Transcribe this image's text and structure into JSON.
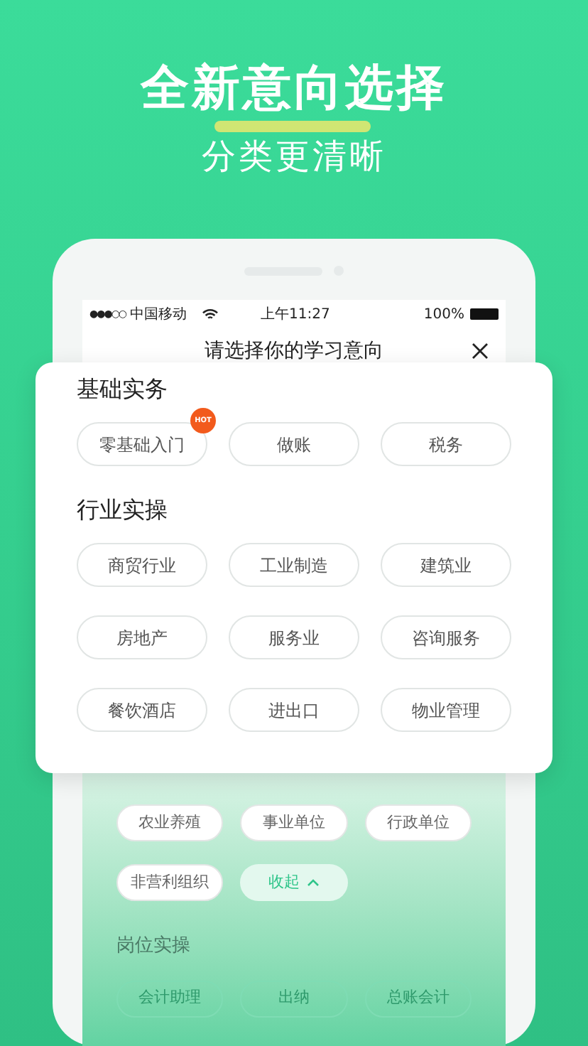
{
  "headline": "全新意向选择",
  "subtitle": "分类更清晰",
  "status_bar": {
    "signal": "●●●○○",
    "carrier": "中国移动",
    "time": "上午11:27",
    "battery": "100%"
  },
  "dialog_title": "请选择你的学习意向",
  "popup_sections": [
    {
      "title": "基础实务",
      "chips": [
        {
          "label": "零基础入门",
          "badge": "HOT"
        },
        {
          "label": "做账"
        },
        {
          "label": "税务"
        }
      ]
    },
    {
      "title": "行业实操",
      "chips": [
        {
          "label": "商贸行业"
        },
        {
          "label": "工业制造"
        },
        {
          "label": "建筑业"
        },
        {
          "label": "房地产"
        },
        {
          "label": "服务业"
        },
        {
          "label": "咨询服务"
        },
        {
          "label": "餐饮酒店"
        },
        {
          "label": "进出口"
        },
        {
          "label": "物业管理"
        }
      ]
    }
  ],
  "background_chips": [
    {
      "label": "农业养殖"
    },
    {
      "label": "事业单位"
    },
    {
      "label": "行政单位"
    },
    {
      "label": "非营利组织"
    }
  ],
  "collapse_button": "收起",
  "background_section": {
    "title": "岗位实操",
    "chips": [
      {
        "label": "会计助理"
      },
      {
        "label": "出纳"
      },
      {
        "label": "总账会计"
      }
    ]
  }
}
